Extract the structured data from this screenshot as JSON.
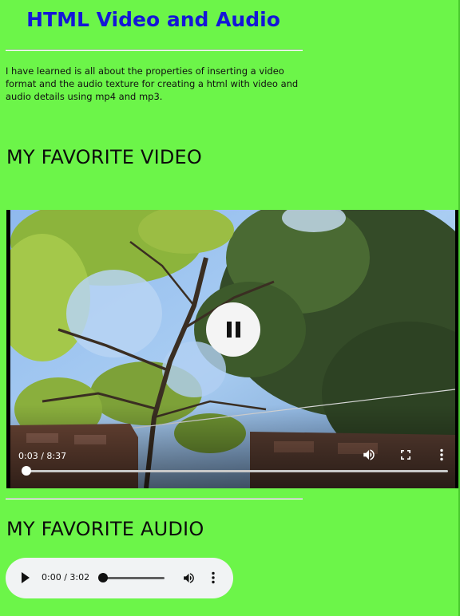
{
  "page": {
    "title": "HTML Video and Audio",
    "intro": "I have learned is all about the properties of inserting a video format and the audio texture for creating a html with video and audio details using mp4 and mp3.",
    "video_heading": "MY FAVORITE VIDEO",
    "audio_heading": "MY FAVORITE AUDIO"
  },
  "colors": {
    "background": "#6cf549",
    "title": "#1416d8"
  },
  "video": {
    "time": "0:03 / 8:37",
    "progress": 0.006,
    "state": "playing",
    "icons": [
      "pause-icon",
      "volume-icon",
      "fullscreen-icon",
      "more-options-icon"
    ]
  },
  "audio": {
    "time": "0:00 / 3:02",
    "progress": 0.0,
    "icons": [
      "play-icon",
      "volume-icon",
      "more-options-icon"
    ]
  }
}
